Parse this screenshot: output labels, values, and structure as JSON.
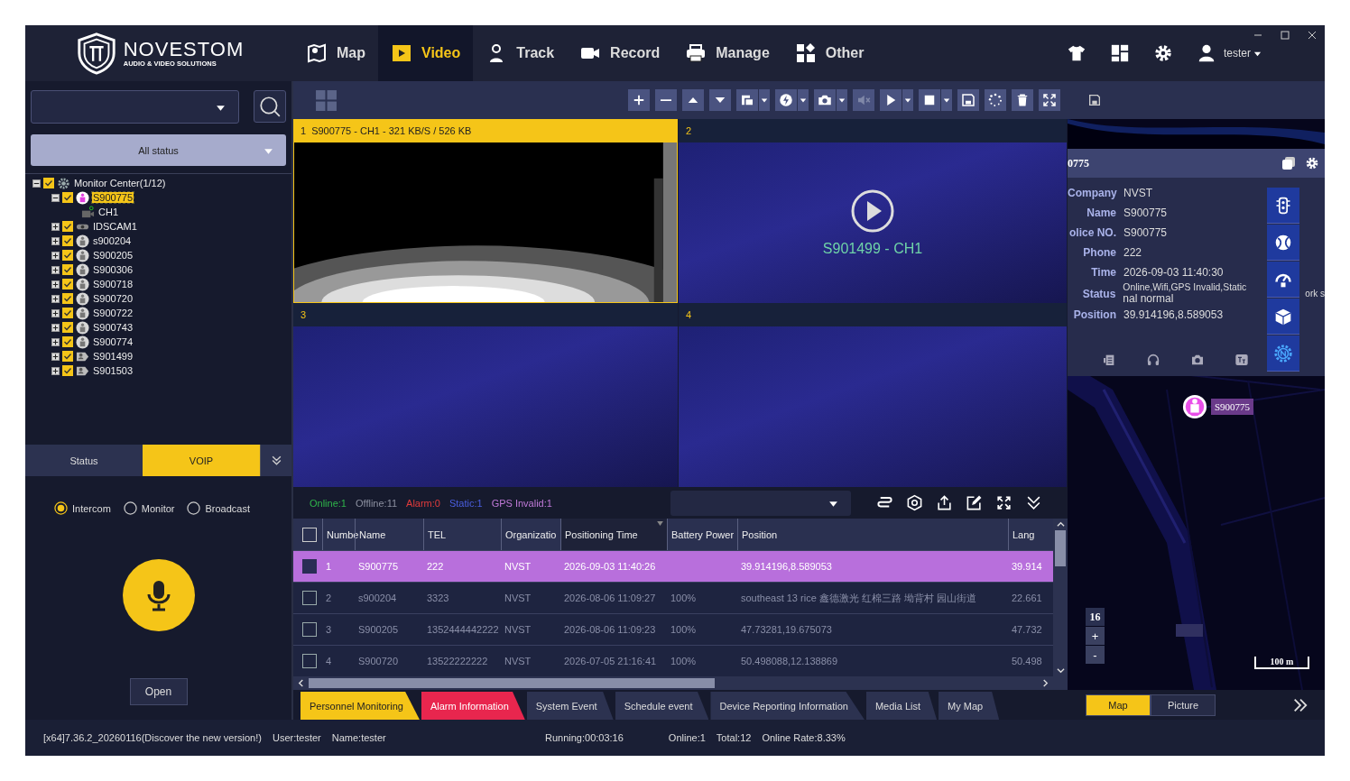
{
  "header": {
    "brand": "NOVESTOM",
    "tagline": "AUDIO & VIDEO SOLUTIONS",
    "user": "tester",
    "nav": [
      {
        "label": "Map",
        "kind": "map",
        "selected": false
      },
      {
        "label": "Video",
        "kind": "video",
        "selected": true
      },
      {
        "label": "Track",
        "kind": "track",
        "selected": false
      },
      {
        "label": "Record",
        "kind": "record",
        "selected": false
      },
      {
        "label": "Manage",
        "kind": "manage",
        "selected": false
      },
      {
        "label": "Other",
        "kind": "other",
        "selected": false
      }
    ]
  },
  "left": {
    "status_filter": "All status",
    "tree": [
      {
        "label": "Monitor Center(1/12)",
        "kind": "center",
        "checked": true,
        "expanded": true,
        "selected": false,
        "children": [
          {
            "label": "S900775",
            "kind": "person-active",
            "checked": true,
            "expanded": true,
            "selected": true,
            "children": [
              {
                "label": "CH1",
                "kind": "channel",
                "selected": false
              }
            ]
          },
          {
            "label": "IDSCAM1",
            "kind": "camera-device",
            "checked": true,
            "expanded": false,
            "selected": false
          },
          {
            "label": "s900204",
            "kind": "person",
            "checked": true,
            "expanded": false,
            "selected": false
          },
          {
            "label": "S900205",
            "kind": "person",
            "checked": true,
            "expanded": false,
            "selected": false
          },
          {
            "label": "S900306",
            "kind": "person",
            "checked": true,
            "expanded": false,
            "selected": false
          },
          {
            "label": "S900718",
            "kind": "person",
            "checked": true,
            "expanded": false,
            "selected": false
          },
          {
            "label": "S900720",
            "kind": "person",
            "checked": true,
            "expanded": false,
            "selected": false
          },
          {
            "label": "S900722",
            "kind": "person",
            "checked": true,
            "expanded": false,
            "selected": false
          },
          {
            "label": "S900743",
            "kind": "person",
            "checked": true,
            "expanded": false,
            "selected": false
          },
          {
            "label": "S900774",
            "kind": "person",
            "checked": true,
            "expanded": false,
            "selected": false
          },
          {
            "label": "S901499",
            "kind": "person-card",
            "checked": true,
            "expanded": false,
            "selected": false
          },
          {
            "label": "S901503",
            "kind": "person-card",
            "checked": true,
            "expanded": false,
            "selected": false
          }
        ]
      }
    ],
    "panel_tabs": [
      {
        "label": "Status",
        "selected": false
      },
      {
        "label": "VOIP",
        "selected": true
      }
    ],
    "modes": [
      {
        "label": "Intercom",
        "selected": true
      },
      {
        "label": "Monitor",
        "selected": false
      },
      {
        "label": "Broadcast",
        "selected": false
      }
    ],
    "open_button": "Open"
  },
  "video": {
    "cells": [
      {
        "number": "1",
        "title": "S900775 - CH1 - 321 KB/S / 526 KB",
        "kind": "live",
        "selected": true
      },
      {
        "number": "2",
        "caption": "S901499 - CH1",
        "kind": "idle",
        "selected": false
      },
      {
        "number": "3",
        "kind": "empty",
        "selected": false
      },
      {
        "number": "4",
        "kind": "empty",
        "selected": false
      }
    ]
  },
  "stats": [
    {
      "label": "Online:1",
      "color": "#2fb54a"
    },
    {
      "label": "Offline:11",
      "color": "#8c90a0"
    },
    {
      "label": "Alarm:0",
      "color": "#e23b3b"
    },
    {
      "label": "Static:1",
      "color": "#4a5ee0"
    },
    {
      "label": "GPS Invalid:1",
      "color": "#c07ad8"
    }
  ],
  "table": {
    "select_all": false,
    "columns": [
      {
        "label": "Numbe",
        "sorted": false
      },
      {
        "label": "Name",
        "sorted": false
      },
      {
        "label": "TEL",
        "sorted": false
      },
      {
        "label": "Organizatio",
        "sorted": false
      },
      {
        "label": "Positioning Time",
        "sorted": true
      },
      {
        "label": "Battery Power",
        "sorted": false
      },
      {
        "label": "Position",
        "sorted": false
      },
      {
        "label": "Lang",
        "sorted": false
      }
    ],
    "rows": [
      {
        "selected": true,
        "checked": false,
        "cells": [
          "1",
          "S900775",
          "222",
          "NVST",
          "2026-09-03 11:40:26",
          "",
          "39.914196,8.589053",
          "39.914"
        ]
      },
      {
        "selected": false,
        "checked": false,
        "cells": [
          "2",
          "s900204",
          "3323",
          "NVST",
          "2026-08-06 11:09:27",
          "100%",
          "southeast 13 rice  鑫德激光 红棉三路 坳背村 园山街道",
          "22.661"
        ]
      },
      {
        "selected": false,
        "checked": false,
        "cells": [
          "3",
          "S900205",
          "1352444442222",
          "NVST",
          "2026-08-06 11:09:23",
          "100%",
          "47.73281,19.675073",
          "47.732"
        ]
      },
      {
        "selected": false,
        "checked": false,
        "cells": [
          "4",
          "S900720",
          "13522222222",
          "NVST",
          "2026-07-05 21:16:41",
          "100%",
          "50.498088,12.138869",
          "50.498"
        ]
      }
    ]
  },
  "bottom_tabs": [
    {
      "label": "Personnel Monitoring",
      "selected": true,
      "alert": false
    },
    {
      "label": "Alarm Information",
      "selected": false,
      "alert": true
    },
    {
      "label": "System Event",
      "selected": false,
      "alert": false
    },
    {
      "label": "Schedule event",
      "selected": false,
      "alert": false
    },
    {
      "label": "Device Reporting Information",
      "selected": false,
      "alert": false
    },
    {
      "label": "Media List",
      "selected": false,
      "alert": false
    },
    {
      "label": "My Map",
      "selected": false,
      "alert": false
    }
  ],
  "info": {
    "title": "0775",
    "fields": [
      {
        "label": "Company",
        "value": "NVST"
      },
      {
        "label": "Name",
        "value": "S900775"
      },
      {
        "label": "olice NO.",
        "value": "S900775"
      },
      {
        "label": "Phone",
        "value": "222"
      },
      {
        "label": "Time",
        "value": "2026-09-03 11:40:30"
      },
      {
        "label": "Status",
        "value": "Online,Wifi,GPS Invalid,Static",
        "continuation": "nal normal",
        "overflow": "ork s"
      },
      {
        "label": "Position",
        "value": "39.914196,8.589053"
      }
    ]
  },
  "map": {
    "marker": "S900775",
    "zoom": "16",
    "zoom_in": "+",
    "zoom_out": "-",
    "scale": "100 m"
  },
  "view_toggle": [
    {
      "label": "Map",
      "selected": true
    },
    {
      "label": "Picture",
      "selected": false
    }
  ],
  "status_bar": {
    "version": "[x64]7.36.2_20260116(Discover the new version!)",
    "user": "User:tester",
    "name": "Name:tester",
    "running": "Running:00:03:16",
    "online": "Online:1",
    "total": "Total:12",
    "rate": "Online Rate:8.33%"
  }
}
